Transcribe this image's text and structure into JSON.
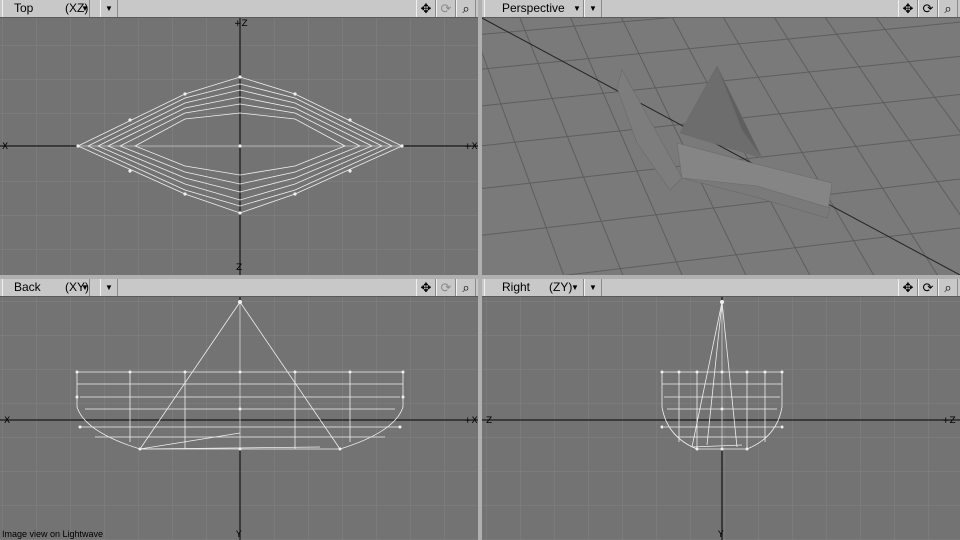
{
  "viewports": {
    "top": {
      "name": "Top",
      "axes": "(XZ)",
      "zoom_left": "Z",
      "zoom_right": "X",
      "label_top": "+Z",
      "label_bottom": "Z",
      "label_left": "X",
      "label_right": "+X"
    },
    "perspective": {
      "name": "Perspective",
      "axes": ""
    },
    "back": {
      "name": "Back",
      "axes": "(XY)",
      "label_top": "+Y",
      "label_bottom": "Y",
      "label_left": "X",
      "label_right": "+X"
    },
    "right": {
      "name": "Right",
      "axes": "(ZY)",
      "label_top": "+Y",
      "label_bottom": "Y",
      "label_left": "Z",
      "label_right": "+Z"
    }
  },
  "icons": {
    "move": "move-icon",
    "rotate": "rotate-icon",
    "zoom": "magnify-icon",
    "dropdown": "dropdown-arrow-icon"
  },
  "colors": {
    "header_bg": "#c8c8c8",
    "viewport_bg": "#737373",
    "grid": "#838383",
    "axis": "#000000",
    "wire": "#f0f0f0"
  },
  "footer": {
    "caption": "Image view on Lightwave"
  }
}
